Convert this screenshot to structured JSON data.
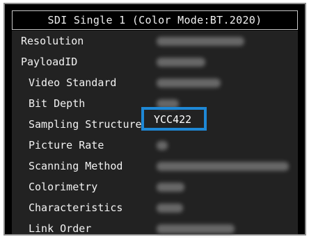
{
  "window": {
    "title": "SDI Single 1 (Color Mode:BT.2020)"
  },
  "rows": [
    {
      "label": "Resolution"
    },
    {
      "label": "PayloadID"
    },
    {
      "label": "Video Standard"
    },
    {
      "label": "Bit Depth"
    },
    {
      "label": "Sampling Structure",
      "value": "YCC422"
    },
    {
      "label": "Picture Rate"
    },
    {
      "label": "Scanning Method"
    },
    {
      "label": "Colorimetry"
    },
    {
      "label": "Characteristics"
    },
    {
      "label": "Link Order"
    }
  ],
  "colors": {
    "highlight": "#1e88d6",
    "panel_bg": "#222222",
    "text": "#f2f2f2"
  }
}
